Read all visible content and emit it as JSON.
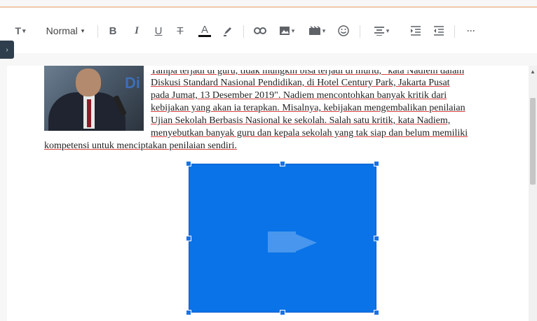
{
  "toolbar": {
    "text_size_label": "T",
    "style_select": "Normal",
    "bold_label": "B",
    "italic_label": "I",
    "underline_label": "U",
    "strike_label": "T",
    "color_label": "A",
    "more_label": "···"
  },
  "document": {
    "lines": [
      "Tampa terjadi di guru, tidak mungkin bisa terjadi di murid,\" kata Nadiem dalam",
      "Diskusi Standard Nasional Pendidikan, di Hotel Century Park, Jakarta Pusat",
      "pada Jumat, 13 Desember 2019\". Nadiem mencontohkan banyak kritik dari",
      "kebijakan yang akan ia terapkan. Misalnya, kebijakan mengembalikan penilaian",
      "Ujian Sekolah Berbasis Nasional ke sekolah. Salah satu kritik, kata Nadiem,",
      "menyebutkan banyak guru dan kepala sekolah yang tak siap dan belum memiliki",
      "kompetensi untuk menciptakan penilaian sendiri."
    ]
  },
  "colors": {
    "image_block": "#0a73e8",
    "accent_line": "#f0c9ad"
  }
}
